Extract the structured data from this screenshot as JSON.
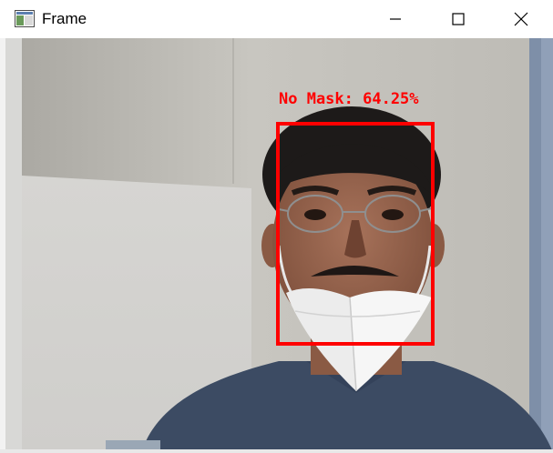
{
  "window": {
    "title": "Frame",
    "icons": {
      "app": "app-window-icon",
      "minimize": "minimize-icon",
      "maximize": "maximize-icon",
      "close": "close-icon"
    }
  },
  "detection": {
    "label": "No Mask: 64.25%",
    "box_color": "#ff0000"
  }
}
